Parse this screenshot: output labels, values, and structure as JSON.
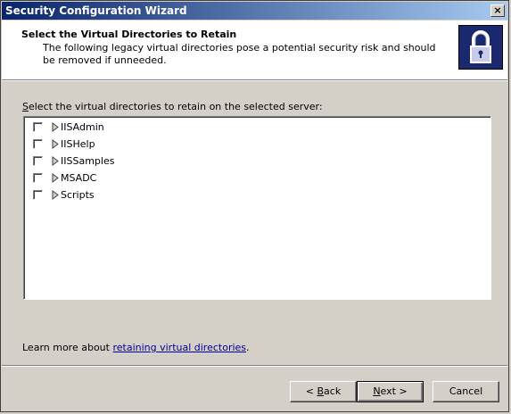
{
  "window": {
    "title": "Security Configuration Wizard",
    "close_label": "×"
  },
  "header": {
    "title": "Select the Virtual Directories to Retain",
    "description": "The following legacy virtual directories pose a potential security risk and should be removed if unneeded.",
    "logo_icon": "padlock-icon"
  },
  "main": {
    "instruction_prefix": "S",
    "instruction_rest": "elect the virtual directories to retain on the selected server:",
    "items": [
      {
        "label": "IISAdmin",
        "checked": false
      },
      {
        "label": "IISHelp",
        "checked": false
      },
      {
        "label": "IISSamples",
        "checked": false
      },
      {
        "label": "MSADC",
        "checked": false
      },
      {
        "label": "Scripts",
        "checked": false
      }
    ],
    "learn_prefix": "Learn more about ",
    "learn_link": "retaining virtual directories",
    "learn_suffix": "."
  },
  "buttons": {
    "back_prefix": "< ",
    "back_accel": "B",
    "back_rest": "ack",
    "next_accel": "N",
    "next_rest": "ext >",
    "cancel": "Cancel"
  }
}
